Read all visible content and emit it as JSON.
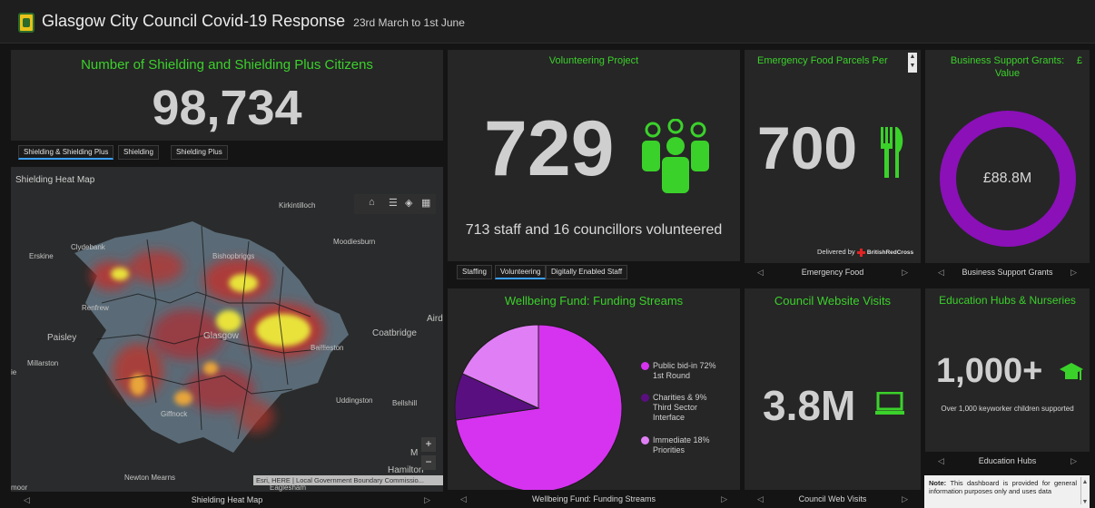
{
  "header": {
    "title": "Glasgow City Council Covid-19 Response",
    "subtitle": "23rd March to 1st June"
  },
  "shielding": {
    "title": "Number of Shielding and Shielding Plus Citizens",
    "value": "98,734",
    "tabs": [
      "Shielding & Shielding Plus",
      "Shielding",
      "Shielding Plus"
    ],
    "active_tab": 0
  },
  "map": {
    "title": "Shielding Heat Map",
    "labels": {
      "kirkintilloch": "Kirkintilloch",
      "clydebank": "Clydebank",
      "erskine": "Erskine",
      "bishopbriggs": "Bishopbriggs",
      "moodiesburn": "Moodiesburn",
      "renfrew": "Renfrew",
      "paisley": "Paisley",
      "glasgow": "Glasgow",
      "baillieston": "Baillieston",
      "coatbridge": "Coatbridge",
      "aird": "Aird",
      "millarston": "Millarston",
      "ie": "ie",
      "uddingston": "Uddingston",
      "bellshill": "Bellshill",
      "giffnock": "Giffnock",
      "mo": "M",
      "newton_mearns": "Newton Mearns",
      "hamilton": "Hamilton",
      "eaglesham": "Eaglesham",
      "moor": "moor"
    },
    "attribution": "Esri, HERE | Local Government Boundary Commissio...",
    "footer": "Shielding Heat Map"
  },
  "volunteering": {
    "title": "Volunteering Project",
    "value": "729",
    "caption": "713 staff and 16 councillors volunteered",
    "tabs": [
      "Staffing",
      "Volunteering",
      "Digitally Enabled Staff"
    ],
    "active_tab": 1
  },
  "food": {
    "title": "Emergency Food Parcels Per",
    "value": "700",
    "delivered_by": "Delivered by",
    "partner": "BritishRedCross",
    "footer": "Emergency Food"
  },
  "grants": {
    "title": "Business Support Grants:",
    "title_line2": "Value",
    "currency": "£",
    "value": "£88.8M",
    "footer": "Business Support Grants",
    "ring_color": "#8b10b8"
  },
  "wellbeing": {
    "title": "Wellbeing Fund: Funding Streams",
    "footer": "Wellbeing Fund: Funding Streams",
    "legend": [
      {
        "line1": "Public bid-in 72%",
        "line2": "1st Round",
        "line3": "",
        "color": "#d633f0"
      },
      {
        "line1": "Charities &   9%",
        "line2": "Third Sector",
        "line3": "Interface",
        "color": "#5a0f80"
      },
      {
        "line1": "Immediate 18%",
        "line2": "Priorities",
        "line3": "",
        "color": "#e07ff5"
      }
    ]
  },
  "chart_data": {
    "type": "pie",
    "title": "Wellbeing Fund: Funding Streams",
    "categories": [
      "Public bid-in 1st Round",
      "Charities & Third Sector Interface",
      "Immediate Priorities"
    ],
    "values": [
      72,
      9,
      18
    ],
    "colors": [
      "#d633f0",
      "#5a0f80",
      "#e07ff5"
    ]
  },
  "website": {
    "title": "Council Website Visits",
    "value": "3.8M",
    "footer": "Council Web Visits"
  },
  "education": {
    "title": "Education Hubs & Nurseries",
    "value": "1,000+",
    "caption": "Over 1,000 keyworker children supported",
    "footer": "Education Hubs"
  },
  "note": {
    "label": "Note:",
    "text": "This dashboard is provided for general information purposes only and uses data"
  },
  "colors": {
    "accent_green": "#3bd12b",
    "panel_bg": "#262626",
    "page_bg": "#141414"
  }
}
